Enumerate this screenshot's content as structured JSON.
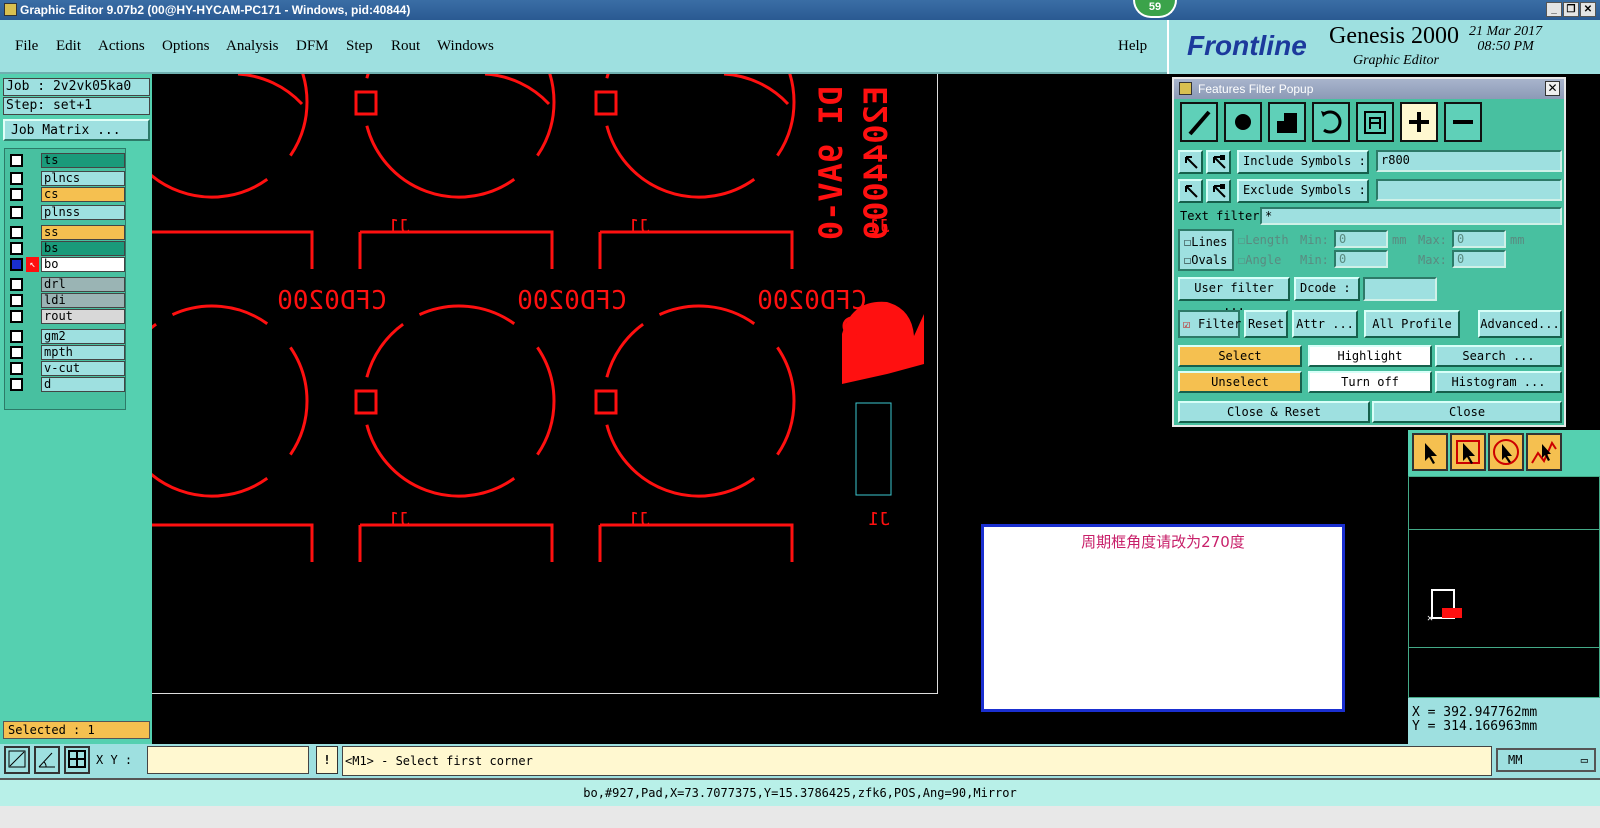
{
  "window": {
    "title": "Graphic Editor 9.07b2 (00@HY-HYCAM-PC171 - Windows, pid:40844)",
    "badge": "59",
    "controls": [
      "_",
      "❐",
      "✕"
    ]
  },
  "menu": {
    "items": [
      "File",
      "Edit",
      "Actions",
      "Options",
      "Analysis",
      "DFM",
      "Step",
      "Rout",
      "Windows"
    ],
    "help": "Help"
  },
  "logo": {
    "brand": "Frontline",
    "product": "Genesis 2000",
    "subtitle": "Graphic Editor",
    "date": "21 Mar 2017",
    "time": "08:50 PM"
  },
  "left": {
    "job": "Job : 2v2vk05ka0",
    "step": "Step: set+1",
    "job_matrix": "Job Matrix ...",
    "layers": [
      {
        "name": "ts",
        "color": "#1a9a7a"
      },
      {
        "name": "plncs",
        "color": "#9ee0e0"
      },
      {
        "name": "cs",
        "color": "#f5c050"
      },
      {
        "name": "plnss",
        "color": "#9ee0e0"
      },
      {
        "name": "ss",
        "color": "#f5c050"
      },
      {
        "name": "bs",
        "color": "#1a9a7a"
      },
      {
        "name": "bo",
        "color": "#ffffff"
      },
      {
        "name": "drl",
        "color": "#9ab4b4"
      },
      {
        "name": "ldi",
        "color": "#9ab4b4"
      },
      {
        "name": "rout",
        "color": "#d8d8d8"
      },
      {
        "name": "gm2",
        "color": "#9ee0e0"
      },
      {
        "name": "mpth",
        "color": "#9ee0e0"
      },
      {
        "name": "v-cut",
        "color": "#9ee0e0"
      },
      {
        "name": "d",
        "color": "#9ee0e0"
      }
    ],
    "selected": "Selected : 1"
  },
  "canvas": {
    "part_label": "CFD0200",
    "ref_label": "J1",
    "vertical_text_1": "DI 9AV-0",
    "vertical_text_2": "E2044009",
    "message": "周期框角度请改为270度"
  },
  "popup": {
    "title": "Features Filter Popup",
    "include_label": "Include Symbols :",
    "include_value": "r800",
    "exclude_label": "Exclude Symbols :",
    "exclude_value": "",
    "text_filter_label": "Text filter",
    "text_filter_value": "*",
    "lines": "Lines",
    "ovals": "Ovals",
    "length": "Length",
    "angle": "Angle",
    "min": "Min:",
    "max": "Max:",
    "zero": "0",
    "unit": "mm",
    "user_filter": "User filter ...",
    "dcode": "Dcode :",
    "filter": "Filter",
    "reset": "Reset",
    "attr": "Attr ...",
    "profile": "All Profile",
    "advanced": "Advanced...",
    "select": "Select",
    "highlight": "Highlight",
    "search": "Search ...",
    "unselect": "Unselect",
    "turn_off": "Turn off",
    "histogram": "Histogram ...",
    "close_reset": "Close & Reset",
    "close": "Close"
  },
  "coords": {
    "x": "X = 392.947762mm",
    "y": "Y = 314.166963mm"
  },
  "bottom": {
    "xy_label": "X Y :",
    "xy_value": "",
    "bang": "!",
    "prompt": "<M1> - Select first corner",
    "units": "MM",
    "status": "bo,#927,Pad,X=73.7077375,Y=15.3786425,zfk6,POS,Ang=90,Mirror"
  },
  "colors": {
    "feature_red": "#ff1010",
    "panel_teal": "#9ee0e0",
    "accent_orange": "#f5c050"
  }
}
